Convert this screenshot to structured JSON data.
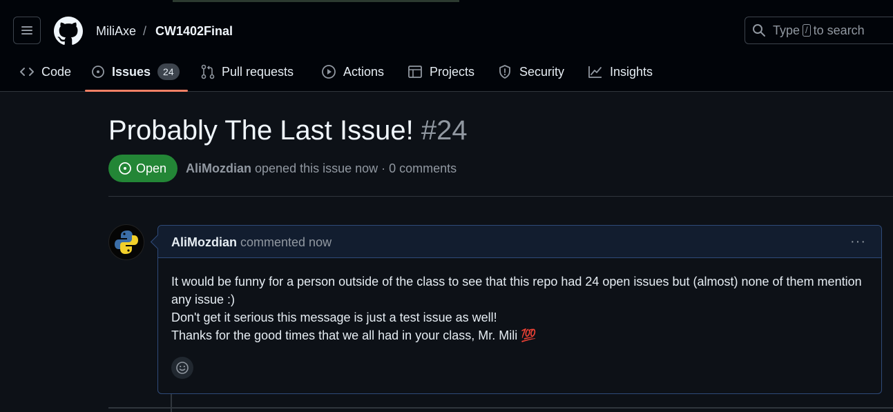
{
  "header": {
    "owner": "MiliAxe",
    "separator": "/",
    "repo": "CW1402Final",
    "search": {
      "prefix": "Type",
      "key": "/",
      "suffix": "to search"
    },
    "icons": {
      "menu": "hamburger-icon",
      "logo": "github-logo-icon",
      "search": "search-icon"
    }
  },
  "tabs": [
    {
      "label": "Code",
      "icon": "code-icon"
    },
    {
      "label": "Issues",
      "icon": "issue-opened-icon",
      "count": "24",
      "active": true
    },
    {
      "label": "Pull requests",
      "icon": "git-pull-request-icon"
    },
    {
      "label": "Actions",
      "icon": "play-icon"
    },
    {
      "label": "Projects",
      "icon": "table-icon"
    },
    {
      "label": "Security",
      "icon": "shield-icon"
    },
    {
      "label": "Insights",
      "icon": "graph-icon"
    }
  ],
  "issue": {
    "title": "Probably The Last Issue!",
    "number": "#24",
    "state": "Open",
    "author": "AliMozdian",
    "meta": "opened this issue now · 0 comments"
  },
  "comment": {
    "author": "AliMozdian",
    "when": "commented now",
    "menu": "···",
    "body": [
      "It would be funny for a person outside of the class to see that this repo had 24 open issues but (almost) none of them mention any issue :)",
      "Don't get it serious this message is just a test issue as well!",
      "Thanks for the good times that we all had in your class, Mr. Mili 💯"
    ]
  },
  "colors": {
    "background": "#0d1117",
    "header_bg": "#010409",
    "open_green": "#238636",
    "active_tab_underline": "#f78166",
    "comment_border": "#2f4b7a"
  }
}
